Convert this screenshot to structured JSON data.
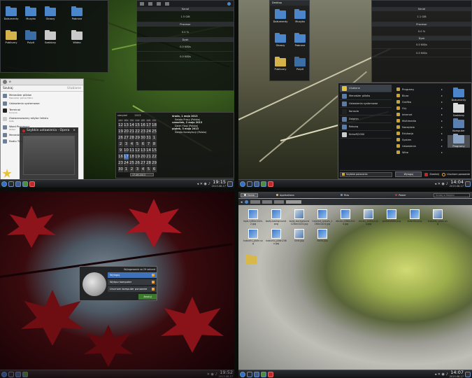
{
  "colors": {
    "accent_blue": "#3f72b8",
    "taskbar": "#1b1d20",
    "menu_bg": "#f4f4f4",
    "hibernate_green": "#3c7a2e",
    "logout_bg": "#1e1e20"
  },
  "q1": {
    "desktop_icons": [
      {
        "label": "Dokumenty",
        "icon": "folder-icon"
      },
      {
        "label": "Muzyka",
        "icon": "folder-music-icon"
      },
      {
        "label": "Obrazy",
        "icon": "folder-images-icon"
      },
      {
        "label": "Pobrane",
        "icon": "folder-download-icon"
      },
      {
        "label": "Publiczny",
        "icon": "folder-public-icon"
      },
      {
        "label": "Pulpit",
        "icon": "folder-desktop-icon"
      },
      {
        "label": "Szablony",
        "icon": "folder-templates-icon"
      },
      {
        "label": "Wideo",
        "icon": "folder-video-icon"
      }
    ],
    "monitor": {
      "cpu_header": "Kanał",
      "cpu_value": "1.5 GiB",
      "proc_header": "Procesor",
      "proc_value": "0.0 %",
      "disk_header": "Dysk",
      "disk_value_1": "0.0 KiB/s",
      "disk_value_2": "0.0 KiB/s"
    },
    "menu": {
      "user_line": "e",
      "search_label": "Szukaj",
      "favorites_label": "Ulubione",
      "items": [
        {
          "title": "Menedżer plików",
          "sub": "Menedżer plików Mikro"
        },
        {
          "title": "Ustawienia systemowe",
          "sub": ""
        },
        {
          "title": "Terminal",
          "sub": "Konsola"
        },
        {
          "title": "Zaawansowany edytor tekstu",
          "sub": "Kate"
        },
        {
          "title": "Word Processor",
          "sub": "Writer"
        },
        {
          "title": "Menedżer okien",
          "sub": ""
        },
        {
          "title": "Radio Tray",
          "sub": ""
        }
      ]
    },
    "dialog_title": "Szybkie ustawienia - Opera",
    "calendar": {
      "month": "sierpień",
      "year": "2013",
      "weekdays": [
        "pon",
        "wto",
        "śro",
        "czw",
        "ptk",
        "sob",
        "nie"
      ],
      "rows": [
        [
          "12",
          "13",
          "14",
          "15",
          "16",
          "17",
          "18"
        ],
        [
          "19",
          "20",
          "21",
          "22",
          "23",
          "24",
          "25"
        ],
        [
          "26",
          "27",
          "28",
          "29",
          "30",
          "31",
          "1"
        ],
        [
          "2",
          "3",
          "4",
          "5",
          "6",
          "7",
          "8"
        ],
        [
          "9",
          "10",
          "11",
          "12",
          "13",
          "14",
          "15"
        ],
        [
          "16",
          "17",
          "18",
          "19",
          "20",
          "21",
          "22"
        ],
        [
          "23",
          "24",
          "25",
          "26",
          "27",
          "28",
          "29"
        ],
        [
          "30",
          "1",
          "2",
          "3",
          "4",
          "5",
          "6"
        ]
      ],
      "today": "17",
      "date_input": "17.08.2013",
      "events": [
        {
          "date": "środa, 1 maja 2013",
          "text": "Święto Pracy (Polska)"
        },
        {
          "date": "czwartek, 2 maja 2013",
          "text": "Dzień Flagi (Polska)"
        },
        {
          "date": "piątek, 3 maja 2013",
          "text": "Święto Konstytucji (Polska)"
        }
      ]
    },
    "clock": {
      "time": "19:15",
      "date": "2013-08-17"
    }
  },
  "q2": {
    "location": "Desktop",
    "desktop_icons": [
      {
        "label": "Dokumenty"
      },
      {
        "label": "Muzyka"
      },
      {
        "label": "Obrazy"
      },
      {
        "label": "Pobrane"
      },
      {
        "label": "Publiczny"
      },
      {
        "label": "Pulpit"
      }
    ],
    "monitor": {
      "h1": "Kanał",
      "v1": "1.1 GiB",
      "h2": "Procesor",
      "v2": "0.0 %",
      "h3": "Dysk",
      "v3": "0.0 KiB/s",
      "v4": "0.0 KiB/s"
    },
    "menu": {
      "left_items": [
        {
          "title": "Ulubione"
        },
        {
          "title": "Menedżer plików",
          "sub": "Menedżer plików Mikro"
        },
        {
          "title": "Ustawienia systemowe"
        },
        {
          "title": "Konsola",
          "sub": "Terminal"
        },
        {
          "title": "Dolphin",
          "sub": "Menedżer plików"
        },
        {
          "title": "Rekonq",
          "sub": "Przeglądarka"
        },
        {
          "title": "Kickoff/2000"
        }
      ],
      "categories": [
        "Programy",
        "Biuro",
        "Grafika",
        "Gry",
        "Internet",
        "Multimedia",
        "Narzędzia",
        "Edukacja",
        "System",
        "Ustawienia",
        "Wine"
      ],
      "right_icons": [
        "Dokumenty",
        "Szablony",
        "Komputer",
        "Programy"
      ],
      "search_placeholder": "Szybkie polecenie",
      "logout_label": "Wyloguj",
      "shutdown_label": "Zamknij",
      "restart_label": "Uruchom ponownie"
    },
    "clock": {
      "time": "14:04",
      "date": "2013-08-17"
    }
  },
  "q3": {
    "logout": {
      "title": "Wylogowanie za 29 sekund",
      "buttons": [
        {
          "label": "Wyloguj",
          "icon": "logout-icon"
        },
        {
          "label": "Wyłącz komputer",
          "icon": "power-icon"
        },
        {
          "label": "Uruchom komputer ponownie",
          "icon": "restart-icon"
        }
      ],
      "cancel": "Anuluj"
    },
    "clock": {
      "time": "19:52",
      "date": "2013-08-17"
    }
  },
  "q4": {
    "tabs": [
      {
        "label": "Home"
      },
      {
        "label": "Applications"
      },
      {
        "label": "Files"
      },
      {
        "label": "Power"
      }
    ],
    "search_placeholder": "Szukaj w Dolphin",
    "files": [
      {
        "label": "lspb-1280x1024-2.jpg"
      },
      {
        "label": "body-background.png"
      },
      {
        "label": "body-background1280x1024.jpg"
      },
      {
        "label": "Colored_Leaves_1280x1024.jpg"
      },
      {
        "label": "ekran-1280x1024.jpg"
      },
      {
        "label": "ekran_1280x1024.jpg"
      },
      {
        "label": "gorbeta800.png"
      },
      {
        "label": "kubuntu.png"
      },
      {
        "label": "kubuntu_plain.png"
      },
      {
        "label": "kubuntu_plain.svg"
      },
      {
        "label": "kubuntu_plain256x.jpg"
      },
      {
        "label": "lime.jpg"
      },
      {
        "label": "Rains.jpg"
      }
    ],
    "clock": {
      "time": "14:07",
      "date": "2013-08-17"
    }
  }
}
